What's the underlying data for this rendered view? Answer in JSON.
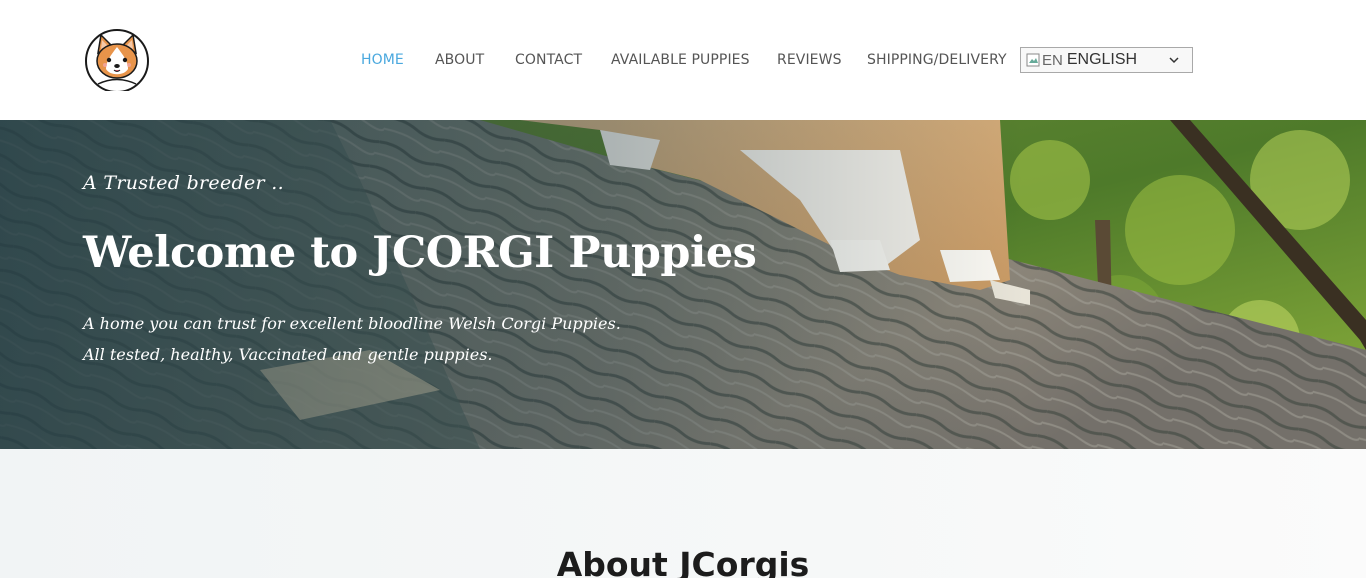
{
  "header": {
    "logo_icon": "corgi-face-logo",
    "nav": [
      {
        "label": "HOME",
        "active": true
      },
      {
        "label": "ABOUT",
        "active": false
      },
      {
        "label": "CONTACT",
        "active": false
      },
      {
        "label": "AVAILABLE PUPPIES",
        "active": false
      },
      {
        "label": "REVIEWS",
        "active": false
      },
      {
        "label": "SHIPPING/DELIVERY",
        "active": false
      }
    ],
    "language": {
      "flag_alt": "EN",
      "selected": "ENGLISH",
      "icon": "chevron-down-icon"
    },
    "accent_color": "#4aa8de"
  },
  "hero": {
    "kicker": "A Trusted breeder ..",
    "title": "Welcome to JCORGI Puppies",
    "subtitle": "A home you can trust for excellent bloodline Welsh Corgi Puppies. All tested, healthy, Vaccinated and gentle puppies."
  },
  "about": {
    "title": "About JCorgis"
  }
}
